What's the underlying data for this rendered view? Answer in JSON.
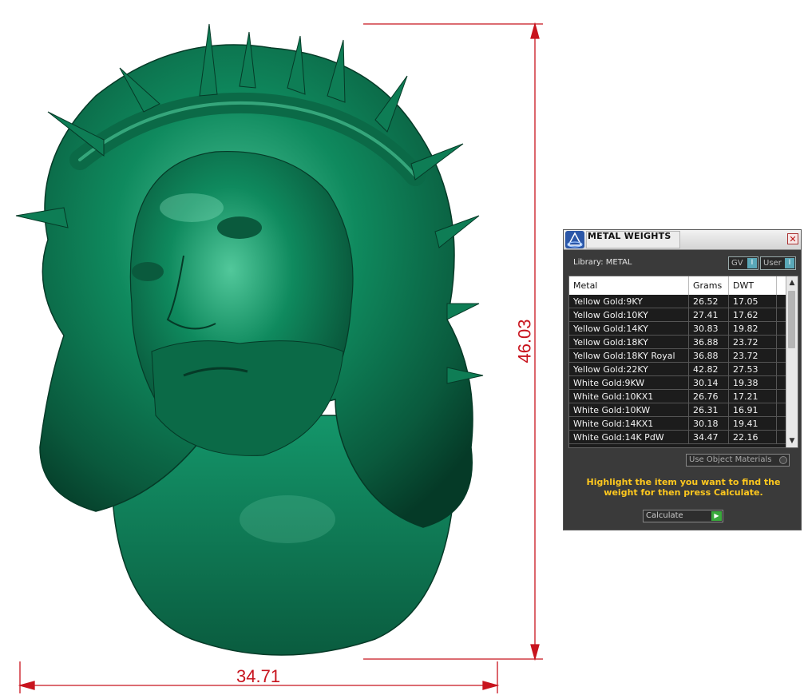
{
  "dimensions": {
    "width_value": "34.71",
    "height_value": "46.03",
    "line_color": "#c8141e"
  },
  "model": {
    "color": "#0d6e4c"
  },
  "panel": {
    "title": "METAL WEIGHTS",
    "close_label": "✕",
    "library_label": "Library: METAL",
    "gv_label": "GV",
    "gv_indicator": "I",
    "user_label": "User",
    "user_indicator": "I",
    "table": {
      "headers": [
        "Metal",
        "Grams",
        "DWT"
      ],
      "rows": [
        [
          "Yellow Gold:9KY",
          "26.52",
          "17.05"
        ],
        [
          "Yellow Gold:10KY",
          "27.41",
          "17.62"
        ],
        [
          "Yellow Gold:14KY",
          "30.83",
          "19.82"
        ],
        [
          "Yellow Gold:18KY",
          "36.88",
          "23.72"
        ],
        [
          "Yellow Gold:18KY Royal",
          "36.88",
          "23.72"
        ],
        [
          "Yellow Gold:22KY",
          "42.82",
          "27.53"
        ],
        [
          "White Gold:9KW",
          "30.14",
          "19.38"
        ],
        [
          "White Gold:10KX1",
          "26.76",
          "17.21"
        ],
        [
          "White Gold:10KW",
          "26.31",
          "16.91"
        ],
        [
          "White Gold:14KX1",
          "30.18",
          "19.41"
        ],
        [
          "White Gold:14K PdW",
          "34.47",
          "22.16"
        ]
      ]
    },
    "use_object_materials_label": "Use Object Materials",
    "instructions": "Highlight the item you want to find the weight for then press Calculate.",
    "calculate_label": "Calculate",
    "accent_color": "#ffc81e"
  }
}
